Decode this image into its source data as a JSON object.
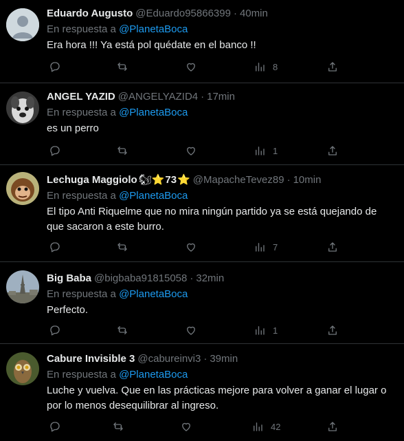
{
  "reply_prefix": "En respuesta a",
  "tweets": [
    {
      "name": "Eduardo Augusto",
      "handle": "@Eduardo95866399",
      "time": "40min",
      "reply_to": "@PlanetaBoca",
      "text": "Era hora !!! Ya está pol quédate en el banco !!",
      "views": "8",
      "avatar": "default-avatar-icon"
    },
    {
      "name": "ANGEL YAZID",
      "handle": "@ANGELYAZID4",
      "time": "17min",
      "reply_to": "@PlanetaBoca",
      "text": "es un perro",
      "views": "1",
      "avatar": "photo-avatar-dog"
    },
    {
      "name": "Lechuga Maggiolo",
      "name_emoji": "🐿",
      "name_star": "⭐",
      "name_number": "73",
      "handle": "@MapacheTevez89",
      "time": "10min",
      "reply_to": "@PlanetaBoca",
      "text": "El tipo Anti Riquelme que no mira ningún partido ya se está quejando de que sacaron a este burro.",
      "views": "7",
      "avatar": "photo-avatar-monkey"
    },
    {
      "name": "Big Baba",
      "handle": "@bigbaba91815058",
      "time": "32min",
      "reply_to": "@PlanetaBoca",
      "text": "Perfecto.",
      "views": "1",
      "avatar": "photo-avatar-tower"
    },
    {
      "name": "Cabure Invisible 3",
      "handle": "@cabureinvi3",
      "time": "39min",
      "reply_to": "@PlanetaBoca",
      "text": "Luche y vuelva. Que en las prácticas mejore para volver a ganar el lugar o por lo menos desequilibrar al ingreso.",
      "views": "42",
      "avatar": "photo-avatar-owl"
    }
  ],
  "colors": {
    "background": "#000000",
    "text": "#e7e9ea",
    "muted": "#71767b",
    "link": "#1d9bf0",
    "divider": "#2f3336"
  }
}
